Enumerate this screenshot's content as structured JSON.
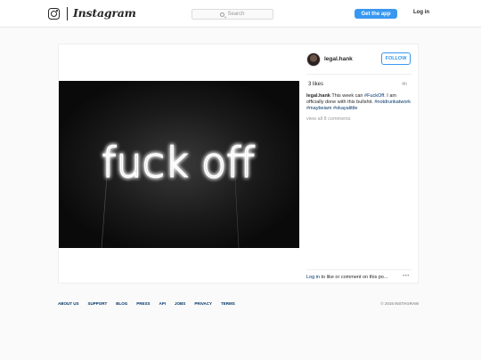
{
  "header": {
    "logo_text": "Instagram",
    "search_placeholder": "Search",
    "get_app_label": "Get the app",
    "login_label": "Log in"
  },
  "post": {
    "username": "legal.hank",
    "follow_label": "FOLLOW",
    "likes": "3 likes",
    "time": "4h",
    "caption_user": "legal.hank",
    "caption_text_1": " This week can ",
    "caption_tag_1": "#FuckOff",
    "caption_text_2": ". I am officially done with this bullshit. ",
    "caption_tag_2": "#notdrunkatwork",
    "caption_tag_3": "#maybeiam",
    "caption_tag_4": "#okayalittle",
    "view_all_comments": "view all 8 comments",
    "login_link": "Log in",
    "comment_prompt": " to like or comment on this po...",
    "more_options": "•••",
    "photo_text": "fuck off"
  },
  "footer": {
    "links": [
      "ABOUT US",
      "SUPPORT",
      "BLOG",
      "PRESS",
      "API",
      "JOBS",
      "PRIVACY",
      "TERMS"
    ],
    "copyright": "© 2016 INSTAGRAM"
  },
  "colors": {
    "accent": "#3897f0",
    "link": "#003569"
  }
}
